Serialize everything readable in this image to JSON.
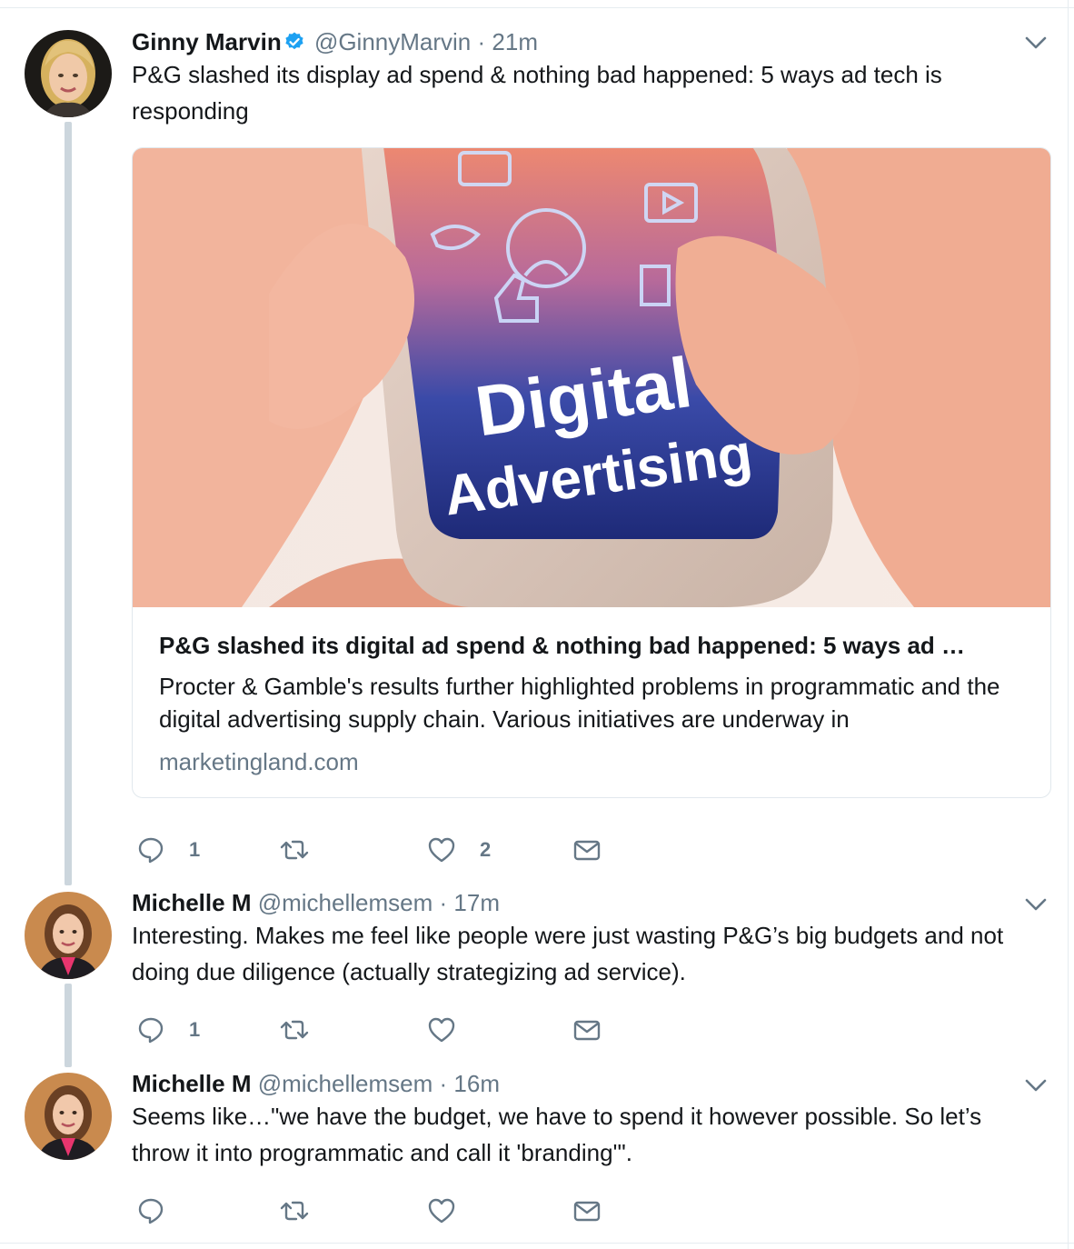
{
  "tweets": [
    {
      "name": "Ginny Marvin",
      "verified": true,
      "handle": "@GinnyMarvin",
      "time": "21m",
      "text": "P&G slashed its display ad spend & nothing bad happened: 5 ways ad tech is responding",
      "card": {
        "image_line1": "Digital",
        "image_line2": "Advertising",
        "title": "P&G slashed its digital ad spend & nothing bad happened: 5 ways ad …",
        "description": "Procter & Gamble's results further highlighted problems in programmatic and the digital advertising supply chain. Various initiatives are underway in",
        "domain": "marketingland.com"
      },
      "actions": {
        "reply_count": "1",
        "retweet_count": "",
        "like_count": "2"
      }
    },
    {
      "name": "Michelle M",
      "handle": "@michellemsem",
      "time": "17m",
      "text": "Interesting. Makes me feel like people were just wasting P&G’s big budgets and not doing due diligence (actually strategizing ad service).",
      "actions": {
        "reply_count": "1",
        "retweet_count": "",
        "like_count": ""
      }
    },
    {
      "name": "Michelle M",
      "handle": "@michellemsem",
      "time": "16m",
      "text": "Seems like…\"we have the budget, we have to spend it however possible. So let’s throw it into programmatic and call it 'branding'\".",
      "actions": {
        "reply_count": "",
        "retweet_count": "",
        "like_count": ""
      }
    }
  ],
  "separator": "·",
  "colors": {
    "text": "#14171a",
    "secondary": "#657786",
    "verified": "#1da1f2",
    "thread_line": "#ccd6dd",
    "border": "#e1e8ed"
  },
  "icons": [
    "verified-badge-icon",
    "chevron-down-icon",
    "reply-icon",
    "retweet-icon",
    "like-icon",
    "direct-message-icon"
  ]
}
